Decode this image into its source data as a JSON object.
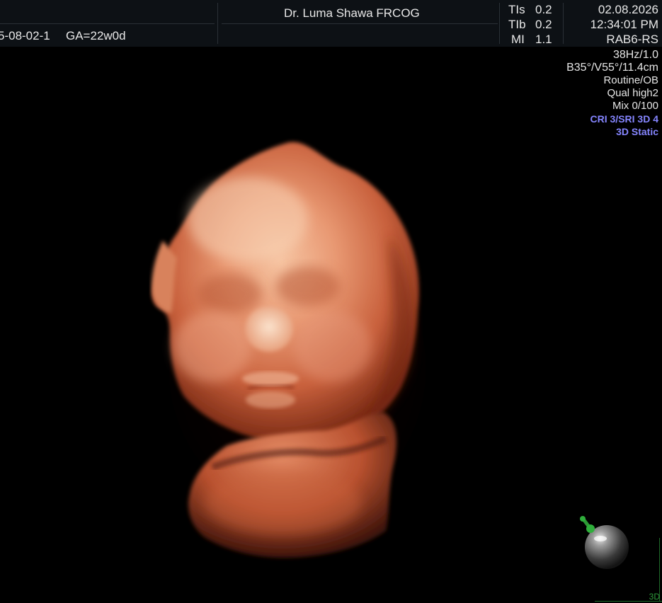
{
  "header": {
    "patient_id": "5-08-02-1",
    "gestational_age": "GA=22w0d",
    "doctor": "Dr. Luma Shawa FRCOG",
    "acoustic": {
      "tis_label": "TIs",
      "tis_value": "0.2",
      "tib_label": "TIb",
      "tib_value": "0.2",
      "mi_label": "MI",
      "mi_value": "1.1"
    },
    "date": "02.08.2026",
    "time": "12:34:01 PM",
    "probe": "RAB6-RS"
  },
  "parameters": {
    "frequency": "38Hz/1.0",
    "volume_angles": "B35°/V55°/11.4cm",
    "preset": "Routine/OB",
    "quality": "Qual high2",
    "mix": "Mix 0/100",
    "cri_sri": "CRI 3/SRI 3D 4",
    "mode": "3D Static"
  },
  "footer": {
    "mode_tag": "3D"
  },
  "colors": {
    "background": "#000000",
    "header_bg": "#0d1115",
    "text": "#e8e8e8",
    "accent_blue": "#8585ff",
    "indicator_green": "#2f9a3c",
    "skin_tone": "#d97a55"
  },
  "icons": {
    "orientation": "orientation-sphere-icon",
    "pin": "green-pin-icon"
  }
}
